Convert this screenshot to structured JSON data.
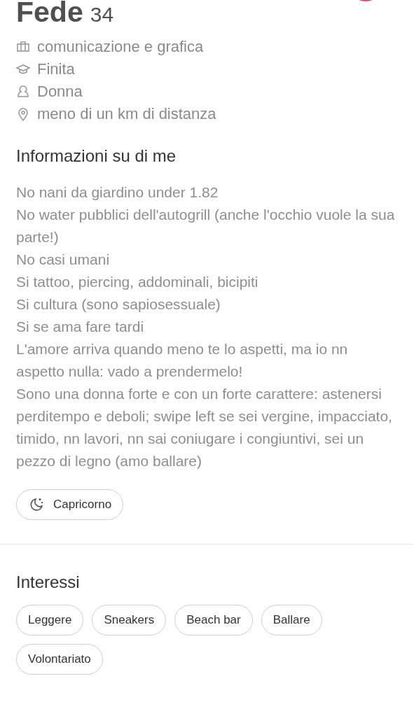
{
  "profile": {
    "name": "Fede",
    "age": "34"
  },
  "details": [
    {
      "kind": "job",
      "text": "comunicazione e grafica"
    },
    {
      "kind": "school",
      "text": "Finita"
    },
    {
      "kind": "gender",
      "text": "Donna"
    },
    {
      "kind": "location",
      "text": "meno di un km di distanza"
    }
  ],
  "about": {
    "title": "Informazioni su di me",
    "lines": [
      "No nani da giardino under 1.82",
      "No water pubblici dell'autogrill (anche l'occhio vuole la sua parte!)",
      "No casi umani",
      "Si tattoo, piercing, addominali, bicipiti",
      "Si cultura (sono sapiosessuale)",
      "Si se ama fare tardi",
      "L'amore arriva quando meno te lo aspetti, ma io nn aspetto nulla: vado a prendermelo!",
      "Sono una donna forte e con un forte carattere: astenersi perditempo e deboli; swipe left se sei vergine, impacciato, timido, nn lavori, nn sai coniugare i congiuntivi, sei un pezzo di legno (amo ballare)"
    ],
    "zodiac": "Capricorno"
  },
  "interests": {
    "title": "Interessi",
    "items": [
      "Leggere",
      "Sneakers",
      "Beach bar",
      "Ballare",
      "Volontariato"
    ]
  }
}
